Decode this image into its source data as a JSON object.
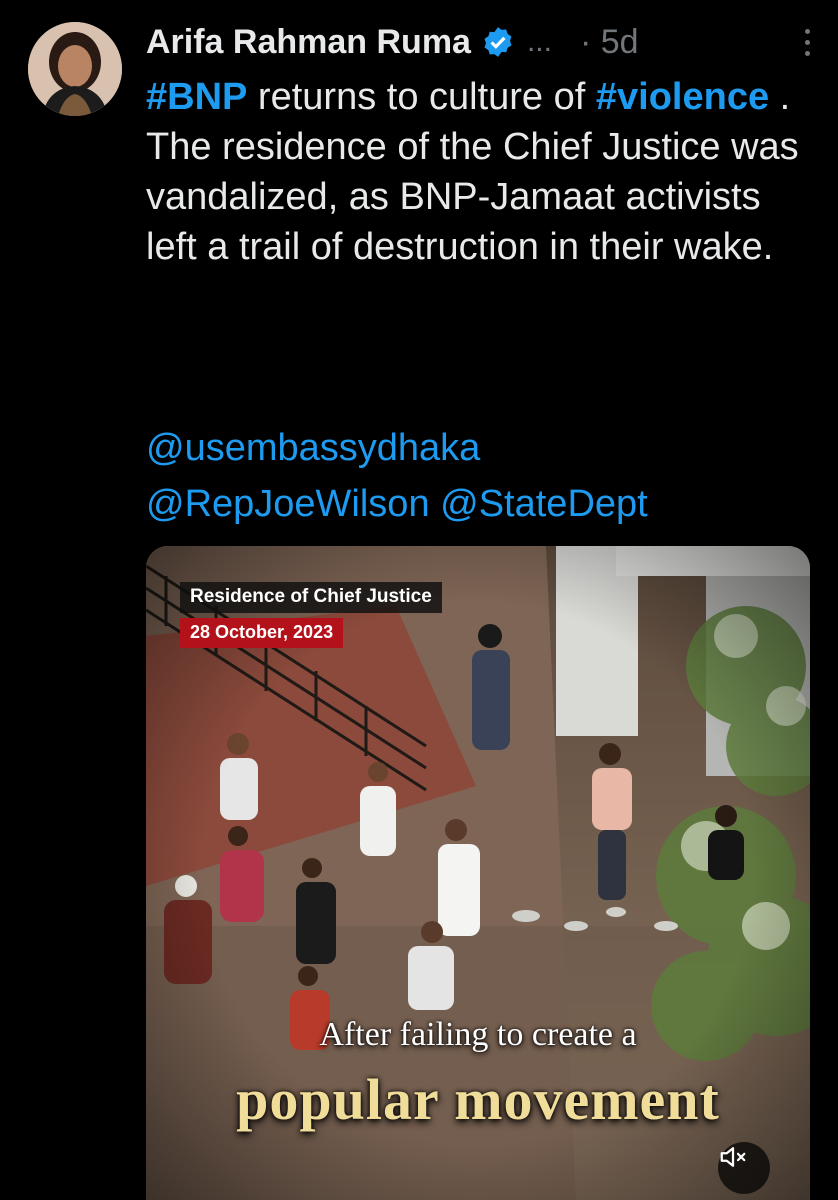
{
  "author": {
    "name": "Arifa Rahman Ruma",
    "overflow": "...",
    "time": "· 5d"
  },
  "tweet": {
    "hashtag1": "#BNP",
    "text1": " returns to culture of ",
    "hashtag2": "#violence",
    "text2": " . The residence of the Chief Justice was vandalized, as BNP-Jamaat activists left a trail of destruction in their wake.",
    "mentions": [
      "@usembassydhaka",
      "@RepJoeWilson",
      "@StateDept"
    ]
  },
  "media": {
    "location_caption": "Residence of Chief Justice",
    "date_caption": "28 October, 2023",
    "subtitle_line1": "After failing to create a",
    "subtitle_line2": "popular movement"
  },
  "icons": {
    "verified": "verified-badge-icon",
    "more": "more-vertical-icon",
    "mute": "volume-muted-icon"
  },
  "colors": {
    "link": "#1d9bf0",
    "text": "#e7e9ea",
    "muted": "#71767b",
    "date_badge": "#b3121b",
    "subtitle_highlight": "#f1dd9a"
  }
}
